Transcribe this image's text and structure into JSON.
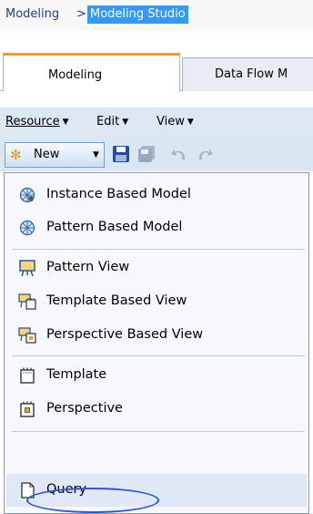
{
  "breadcrumb": {
    "parent": "Modeling",
    "separator": ">",
    "current": "Modeling Studio"
  },
  "tabs": [
    {
      "label": "Modeling",
      "active": true
    },
    {
      "label": "Data Flow M",
      "active": false
    }
  ],
  "menubar": [
    "Resource",
    "Edit",
    "View"
  ],
  "toolbar": {
    "new_label": "New",
    "icons": [
      "new-icon",
      "save-icon",
      "save-all-icon",
      "undo-icon",
      "redo-icon"
    ]
  },
  "new_menu": {
    "groups": [
      [
        {
          "label": "Instance Based Model",
          "icon": "instance-model-icon"
        },
        {
          "label": "Pattern Based Model",
          "icon": "pattern-model-icon"
        }
      ],
      [
        {
          "label": "Pattern View",
          "icon": "pattern-view-icon"
        },
        {
          "label": "Template Based View",
          "icon": "template-view-icon"
        },
        {
          "label": "Perspective Based View",
          "icon": "perspective-view-icon"
        }
      ],
      [
        {
          "label": "Template",
          "icon": "template-icon"
        },
        {
          "label": "Perspective",
          "icon": "perspective-icon"
        }
      ],
      [
        {
          "label": "Query",
          "icon": "query-icon",
          "highlighted": true
        }
      ]
    ]
  },
  "colors": {
    "selection_highlight": "#3399ff",
    "active_tab_accent": "#f59a23",
    "annotation_ellipse": "#2b57d9"
  }
}
